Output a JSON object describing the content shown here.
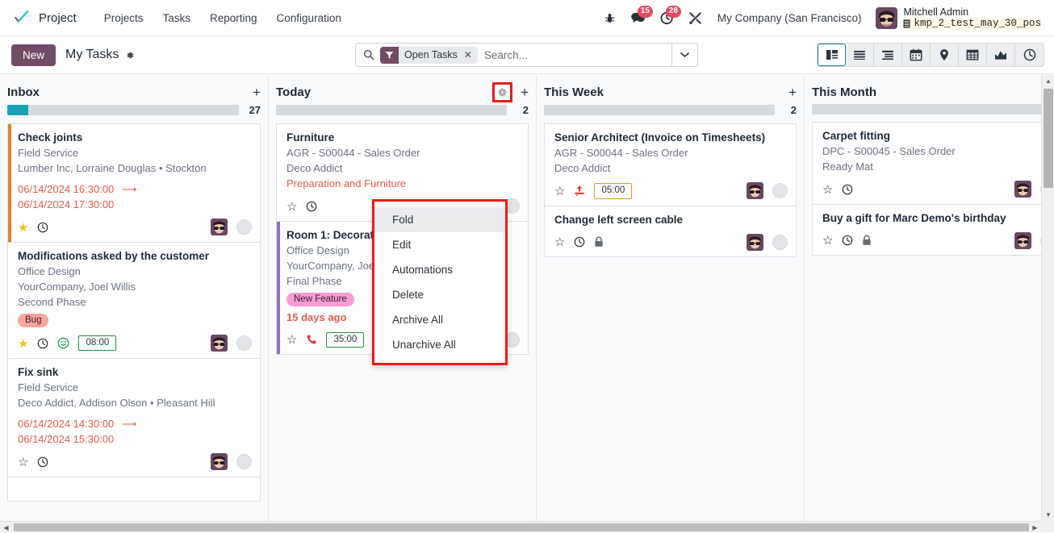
{
  "navbar": {
    "logo_icon": "odoo-checkmark-logo",
    "app_name": "Project",
    "menu_items": [
      {
        "label": "Projects",
        "name": "nav-projects"
      },
      {
        "label": "Tasks",
        "name": "nav-tasks"
      },
      {
        "label": "Reporting",
        "name": "nav-reporting"
      },
      {
        "label": "Configuration",
        "name": "nav-configuration"
      }
    ],
    "systray": {
      "bug_icon": "bug-icon",
      "messages_icon": "chat-bubble-icon",
      "messages_count": "15",
      "activities_icon": "clock-icon",
      "activities_count": "28",
      "tools_icon": "wrench-screwdriver-icon",
      "company": "My Company (San Francisco)",
      "user_name": "Mitchell Admin",
      "database": "kmp_2_test_may_30_pos",
      "database_icon": "database-icon"
    }
  },
  "control_panel": {
    "new_label": "New",
    "breadcrumb": "My Tasks",
    "breadcrumb_gear_icon": "gear-icon",
    "search": {
      "icon": "search-icon",
      "facet_icon": "filter-icon",
      "facet_label": "Open Tasks",
      "facet_remove_icon": "close-icon",
      "placeholder": "Search...",
      "toggle_icon": "chevron-down-icon"
    },
    "views": [
      {
        "name": "view-kanban",
        "icon": "kanban-icon",
        "active": true
      },
      {
        "name": "view-list",
        "icon": "list-icon",
        "active": false
      },
      {
        "name": "view-list-grouped",
        "icon": "list-grouped-icon",
        "active": false
      },
      {
        "name": "view-calendar",
        "icon": "calendar-icon",
        "active": false
      },
      {
        "name": "view-map",
        "icon": "map-pin-icon",
        "active": false
      },
      {
        "name": "view-pivot",
        "icon": "pivot-table-icon",
        "active": false
      },
      {
        "name": "view-graph",
        "icon": "graph-icon",
        "active": false
      },
      {
        "name": "view-activity",
        "icon": "activity-clock-icon",
        "active": false
      }
    ]
  },
  "columns": [
    {
      "name": "column-inbox",
      "title": "Inbox",
      "count": "27",
      "gear_highlighted": false,
      "progress": [
        {
          "color": "#17a2b8",
          "width_pct": 9
        }
      ],
      "cards": [
        {
          "name": "card-check-joints",
          "title": "Check joints",
          "accent_color": "#e08520",
          "sub1": "Field Service",
          "sub2": "Lumber Inc, Lorraine Douglas • Stockton",
          "date_start": "06/14/2024 16:30:00",
          "date_end": "06/14/2024 17:30:00",
          "icons": [
            "star-filled-icon",
            "clock-icon"
          ],
          "has_avatar": true,
          "has_circle": true
        },
        {
          "name": "card-modifications",
          "title": "Modifications asked by the customer",
          "sub1": "Office Design",
          "sub2": "YourCompany, Joel Willis",
          "sub3": "Second Phase",
          "tag": {
            "label": "Bug",
            "bg": "#fba5a0",
            "color": "#3c2020"
          },
          "icons": [
            "star-filled-icon",
            "clock-icon",
            "smiley-icon"
          ],
          "time_badge": "08:00",
          "time_badge_color": "#1e8e3e",
          "has_avatar": true,
          "has_circle": true
        },
        {
          "name": "card-fix-sink",
          "title": "Fix sink",
          "sub1": "Field Service",
          "sub2": "Deco Addict, Addison Olson • Pleasant Hill",
          "date_start": "06/14/2024 14:30:00",
          "date_end": "06/14/2024 15:30:00",
          "icons": [
            "star-outline-icon",
            "clock-icon"
          ],
          "has_avatar": true,
          "has_circle": true
        }
      ]
    },
    {
      "name": "column-today",
      "title": "Today",
      "count": "2",
      "gear_highlighted": true,
      "progress": [],
      "cards": [
        {
          "name": "card-furniture",
          "title": "Furniture",
          "sub1": "AGR - S00044 - Sales Order",
          "sub2": "Deco Addict",
          "red_line": "Preparation and Furniture",
          "icons": [
            "star-outline-icon",
            "clock-icon"
          ],
          "has_avatar": false,
          "has_circle": true
        },
        {
          "name": "card-room-1-decoration",
          "title": "Room 1: Decoration",
          "accent_color": "#8f6fc9",
          "sub1": "Office Design",
          "sub2": "YourCompany, Joel Willis",
          "sub3": "Final Phase",
          "tag": {
            "label": "New Feature",
            "bg": "#f99ad4",
            "color": "#3c2030"
          },
          "red_line": "15 days ago",
          "icons": [
            "star-outline-icon",
            "phone-icon"
          ],
          "time_badge": "35:00",
          "time_badge_color": "#1e8e3e",
          "has_avatar": true,
          "has_circle": true
        }
      ]
    },
    {
      "name": "column-this-week",
      "title": "This Week",
      "count": "2",
      "gear_highlighted": false,
      "progress": [],
      "cards": [
        {
          "name": "card-senior-architect",
          "title": "Senior Architect (Invoice on Timesheets)",
          "sub1": "AGR - S00044 - Sales Order",
          "sub2": "Deco Addict",
          "icons": [
            "star-outline-icon",
            "upload-icon"
          ],
          "time_badge": "05:00",
          "time_badge_color": "#e09b20",
          "has_avatar": true,
          "has_circle": true
        },
        {
          "name": "card-change-left-screen-cable",
          "title": "Change left screen cable",
          "icons": [
            "star-outline-icon",
            "clock-icon",
            "lock-icon"
          ],
          "has_avatar": true,
          "has_circle": true
        }
      ]
    },
    {
      "name": "column-this-month",
      "title": "This Month",
      "count": "",
      "gear_highlighted": false,
      "progress": [],
      "cards": [
        {
          "name": "card-carpet-fitting",
          "title": "Carpet fitting",
          "sub1": "DPC - S00045 - Sales Order",
          "sub2": "Ready Mat",
          "icons": [
            "star-outline-icon",
            "clock-icon"
          ],
          "has_avatar": true,
          "has_circle": true
        },
        {
          "name": "card-buy-a-gift",
          "title": "Buy a gift for Marc Demo's birthday",
          "icons": [
            "star-outline-icon",
            "clock-icon",
            "lock-icon"
          ],
          "has_avatar": true,
          "has_circle": true
        }
      ]
    }
  ],
  "column_dropdown": {
    "name": "column-config-dropdown",
    "items": [
      {
        "label": "Fold",
        "name": "menu-fold",
        "active": true
      },
      {
        "label": "Edit",
        "name": "menu-edit",
        "active": false
      },
      {
        "label": "Automations",
        "name": "menu-automations",
        "active": false
      },
      {
        "label": "Delete",
        "name": "menu-delete",
        "active": false
      },
      {
        "label": "Archive All",
        "name": "menu-archive-all",
        "active": false
      },
      {
        "label": "Unarchive All",
        "name": "menu-unarchive-all",
        "active": false
      }
    ]
  },
  "colors": {
    "brand_purple": "#714b67",
    "highlight_red": "#f01a1a",
    "progress_teal": "#17a2b8",
    "date_red": "#e15b4d",
    "badge_red": "#e6485e"
  }
}
